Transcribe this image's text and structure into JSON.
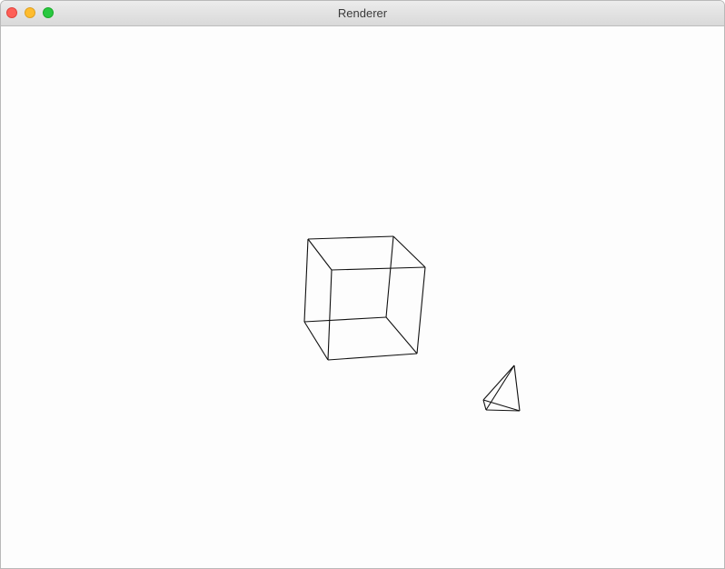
{
  "window": {
    "title": "Renderer"
  },
  "scene": {
    "background_color": "#fdfdfd",
    "line_color": "#111111",
    "objects": [
      "cube-wireframe",
      "tetrahedron-wireframe"
    ]
  }
}
